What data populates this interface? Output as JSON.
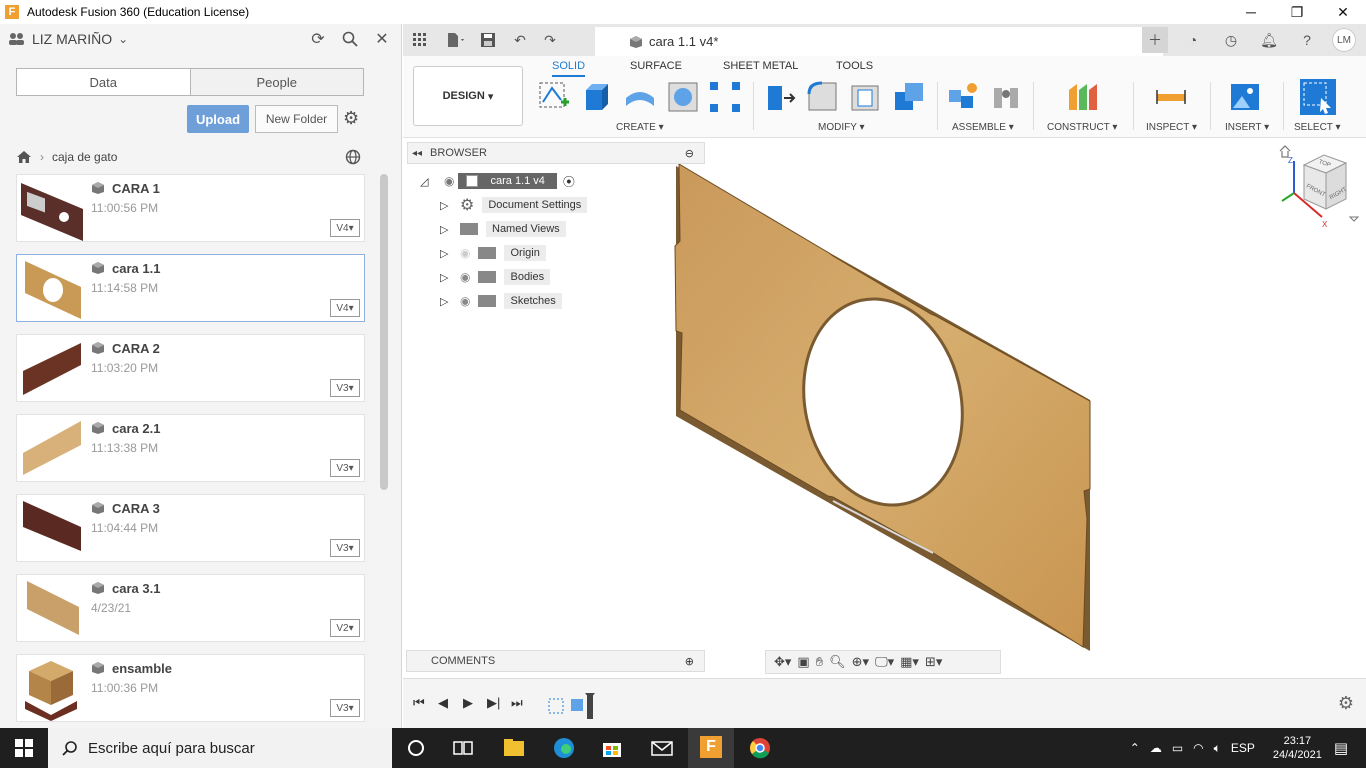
{
  "window": {
    "title": "Autodesk Fusion 360 (Education License)",
    "minimize": "─",
    "maximize": "❐",
    "close": "✕"
  },
  "data_panel": {
    "user_name": "LIZ MARIÑO",
    "tabs": [
      "Data",
      "People"
    ],
    "upload_label": "Upload",
    "new_folder_label": "New Folder",
    "breadcrumb_folder": "caja de gato",
    "files": [
      {
        "name": "CARA 1",
        "time": "11:00:56 PM",
        "version": "V4"
      },
      {
        "name": "cara 1.1",
        "time": "11:14:58 PM",
        "version": "V4"
      },
      {
        "name": "CARA 2",
        "time": "11:03:20 PM",
        "version": "V3"
      },
      {
        "name": "cara 2.1",
        "time": "11:13:38 PM",
        "version": "V3"
      },
      {
        "name": "CARA 3",
        "time": "11:04:44 PM",
        "version": "V3"
      },
      {
        "name": "cara 3.1",
        "time": "4/23/21",
        "version": "V2"
      },
      {
        "name": "ensamble",
        "time": "11:00:36 PM",
        "version": "V3"
      }
    ]
  },
  "doc_tab": {
    "name": "cara 1.1 v4*"
  },
  "toolbar": {
    "workspace": "DESIGN",
    "tabs": [
      "SOLID",
      "SURFACE",
      "SHEET METAL",
      "TOOLS"
    ],
    "groups": [
      "CREATE",
      "MODIFY",
      "ASSEMBLE",
      "CONSTRUCT",
      "INSPECT",
      "INSERT",
      "SELECT"
    ]
  },
  "browser": {
    "title": "BROWSER",
    "root": "cara 1.1 v4",
    "items": [
      "Document Settings",
      "Named Views",
      "Origin",
      "Bodies",
      "Sketches"
    ]
  },
  "comments_title": "COMMENTS",
  "viewcube": {
    "top": "TOP",
    "front": "FRONT",
    "right": "RIGHT",
    "z_axis": "Z",
    "x_axis": "X"
  },
  "user_initials": "LM",
  "taskbar": {
    "search_placeholder": "Escribe aquí para buscar",
    "language": "ESP",
    "time": "23:17",
    "date": "24/4/2021"
  },
  "colors": {
    "accent": "#1f7ad6",
    "upload": "#6f9fd8",
    "wood": "#c89a55",
    "taskbar": "#1f1f1f"
  }
}
